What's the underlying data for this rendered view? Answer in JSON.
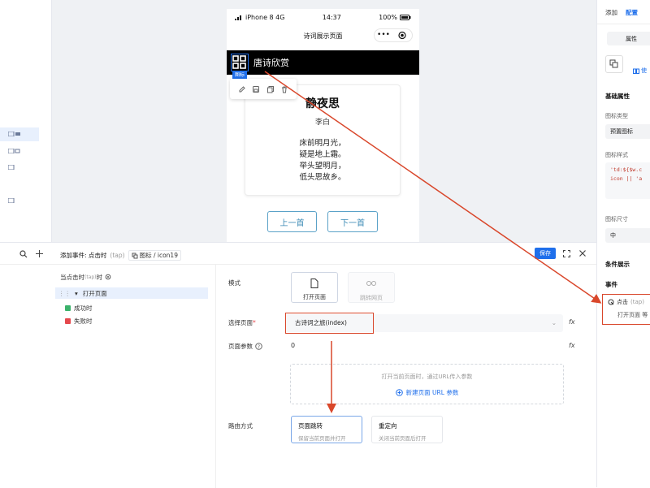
{
  "phone": {
    "status_carrier": "iPhone 8  4G",
    "status_time": "14:37",
    "status_battery": "100%",
    "page_title": "诗词展示页面",
    "capsule_more": "•••",
    "header_title": "唐诗欣赏",
    "selected_tag": "图标",
    "poem": {
      "title": "静夜思",
      "author": "李白",
      "lines": [
        "床前明月光，",
        "疑是地上霜。",
        "举头望明月，",
        "低头思故乡。"
      ]
    },
    "prev_button": "上一首",
    "next_button": "下一首"
  },
  "right_panel": {
    "tab_add": "添加",
    "tab_config": "配置",
    "seg_label": "属性",
    "link_text": "使",
    "basic_props": "基础属性",
    "icon_type_label": "图标类型",
    "icon_type_value": "预置图标",
    "icon_style_label": "图标样式",
    "icon_style_code": [
      "'td:${$w.c",
      "icon || 'a"
    ],
    "icon_size_label": "图标尺寸",
    "icon_size_value": "中",
    "conditional": "条件展示",
    "events": "事件",
    "event_name": "点击",
    "event_tap": "(tap)",
    "event_action": "打开页面 等"
  },
  "bottom": {
    "header_title": "添加事件: 点击时",
    "header_tap": "(tap)",
    "breadcrumb": "图标 / icon19",
    "save_button": "保存",
    "trigger_label": "当点击时",
    "trigger_tap": "(tap)",
    "trigger_suffix": "时",
    "action_open_page": "打开页面",
    "on_success": "成功时",
    "on_fail": "失败时",
    "mode_label": "模式",
    "mode_open_page": "打开页面",
    "mode_link": "跳转网页",
    "select_page_label": "选择页面",
    "select_page_value": "古诗词之旅(index)",
    "page_params_label": "页面参数",
    "page_params_value": "0",
    "params_hint": "打开当前页面时，通过URL传入参数",
    "add_param": "新建页面 URL 参数",
    "route_label": "路由方式",
    "route_navigate": "页面跳转",
    "route_navigate_desc": "保留当前页面并打开",
    "route_redirect": "重定向",
    "route_redirect_desc": "关闭当前页面后打开"
  },
  "colors": {
    "accent": "#1f6feb",
    "annotation_red": "#d9472b",
    "success": "#3bb26b",
    "danger": "#e5484d"
  }
}
